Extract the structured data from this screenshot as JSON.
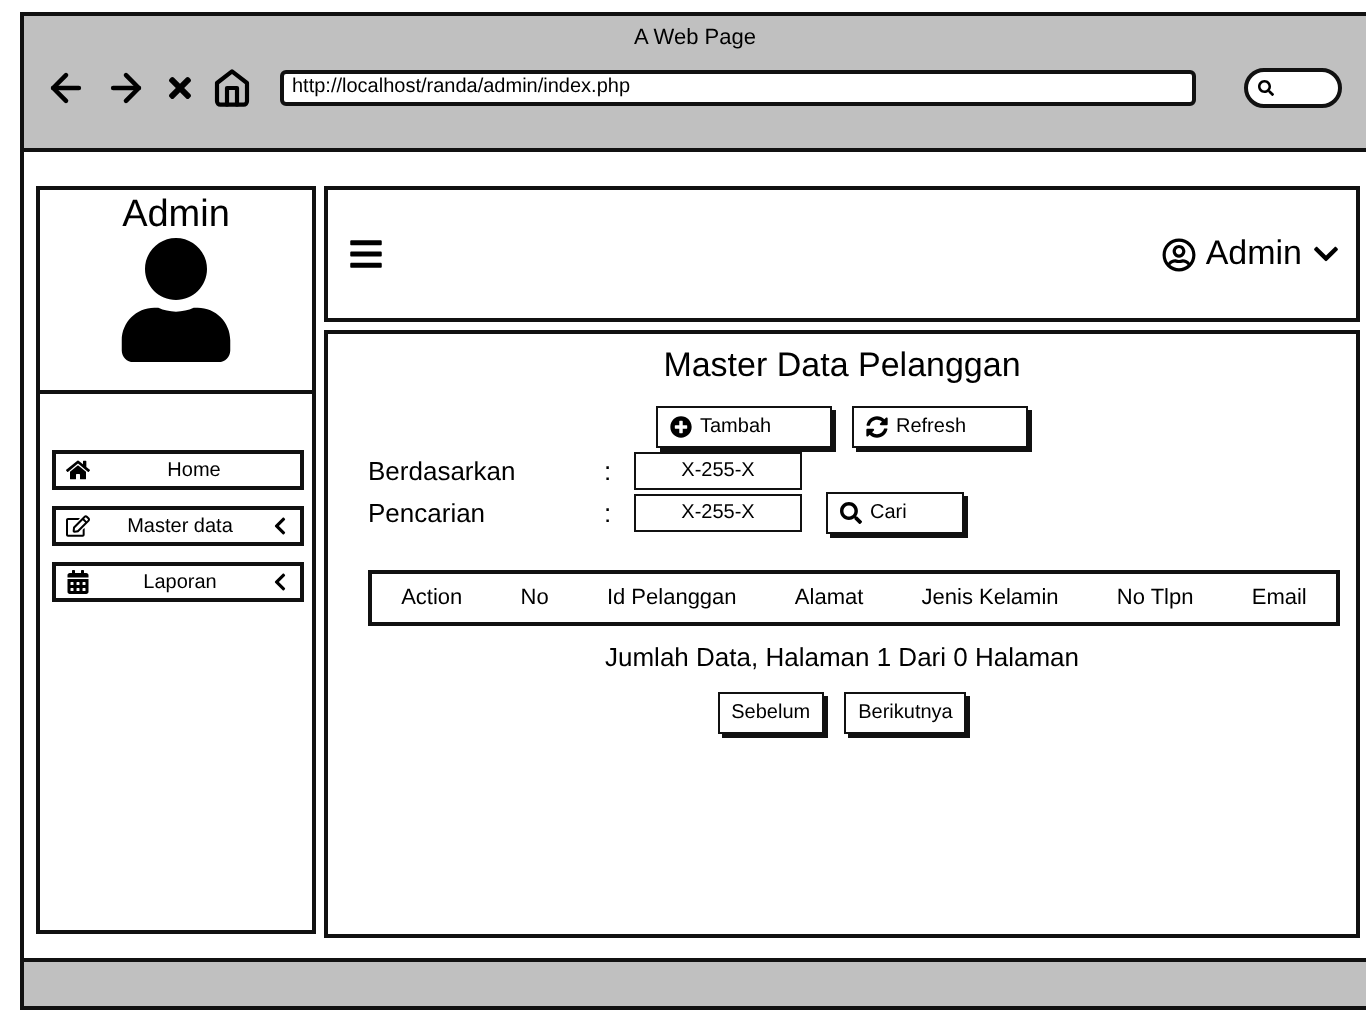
{
  "browser": {
    "title": "A Web Page",
    "url": "http://localhost/randa/admin/index.php"
  },
  "sidebar": {
    "title": "Admin",
    "items": [
      {
        "label": "Home",
        "kind": "link"
      },
      {
        "label": "Master data",
        "kind": "submenu"
      },
      {
        "label": "Laporan",
        "kind": "submenu"
      }
    ]
  },
  "header": {
    "user": "Admin"
  },
  "page": {
    "title": "Master Data Pelanggan",
    "actions": [
      {
        "label": "Tambah"
      },
      {
        "label": "Refresh"
      }
    ],
    "filters": [
      {
        "label": "Berdasarkan",
        "separator": ":",
        "value": "X-255-X"
      },
      {
        "label": "Pencarian",
        "separator": ":",
        "value": "X-255-X",
        "button": "Cari"
      }
    ],
    "table": {
      "columns": [
        "Action",
        "No",
        "Id Pelanggan",
        "Alamat",
        "Jenis Kelamin",
        "No Tlpn",
        "Email"
      ]
    },
    "summary": "Jumlah Data, Halaman 1 Dari 0 Halaman",
    "pager": [
      "Sebelum",
      "Berikutnya"
    ]
  }
}
